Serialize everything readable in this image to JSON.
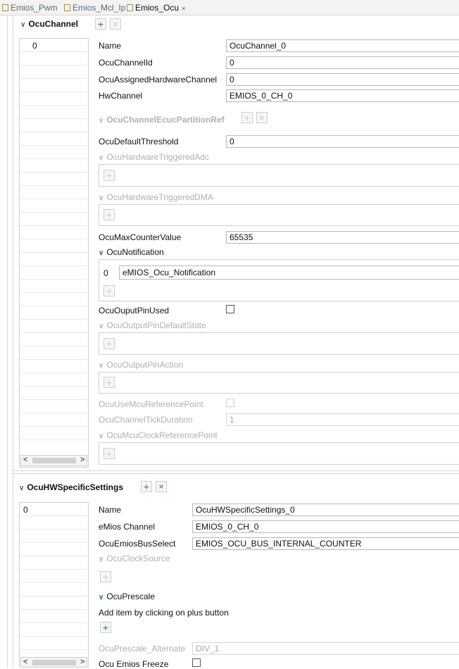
{
  "tabs": [
    {
      "label": "Emios_Pwm"
    },
    {
      "label": "Emios_Mcl_Ip"
    },
    {
      "label": "Emios_Ocu",
      "close": "✕"
    }
  ],
  "ocu_channel": {
    "title": "OcuChannel",
    "list_items": [
      "0"
    ],
    "fields": {
      "name": {
        "label": "Name",
        "value": "OcuChannel_0"
      },
      "channel_id": {
        "label": "OcuChannelId",
        "value": "0"
      },
      "assigned_hw": {
        "label": "OcuAssignedHardwareChannel",
        "value": "0"
      },
      "hw_channel": {
        "label": "HwChannel",
        "value": "EMIOS_0_CH_0"
      },
      "ecuc_ref": {
        "label": "OcuChannelEcucPartitionRef"
      },
      "default_threshold": {
        "label": "OcuDefaultThreshold",
        "value": "0"
      },
      "hw_triggered_adc": {
        "label": "OcuHardwareTriggeredAdc"
      },
      "hw_triggered_dma": {
        "label": "OcuHardwareTriggeredDMA"
      },
      "max_counter": {
        "label": "OcuMaxCounterValue",
        "value": "65535"
      },
      "notification": {
        "label": "OcuNotification",
        "index": "0",
        "value": "eMIOS_Ocu_Notification"
      },
      "output_pin_used": {
        "label": "OcuOuputPinUsed",
        "checked": false
      },
      "output_pin_default_state": {
        "label": "OcuOutputPinDefaultState"
      },
      "output_pin_action": {
        "label": "OcuOutputPinAction"
      },
      "use_mcu_ref_point": {
        "label": "OcuUseMcuReferencePoint",
        "checked": false
      },
      "tick_duration": {
        "label": "OcuChannelTickDuration",
        "value": "1"
      },
      "mcu_clock_ref_point": {
        "label": "OcuMcuClockReferencePoint"
      }
    }
  },
  "hw_specific": {
    "title": "OcuHWSpecificSettings",
    "list_items": [
      "0"
    ],
    "fields": {
      "name": {
        "label": "Name",
        "value": "OcuHWSpecificSettings_0"
      },
      "emios_channel": {
        "label": "eMios Channel",
        "value": "EMIOS_0_CH_0"
      },
      "bus_select": {
        "label": "OcuEmiosBusSelect",
        "value": "EMIOS_OCU_BUS_INTERNAL_COUNTER"
      },
      "clock_source": {
        "label": "OcuClockSource"
      },
      "prescale": {
        "label": "OcuPrescale",
        "hint": "Add item by clicking on plus button"
      },
      "prescale_alt": {
        "label": "OcuPrescale_Alternate",
        "value": "DIV_1"
      },
      "freeze": {
        "label": "Ocu Emios Freeze",
        "checked": false
      }
    }
  },
  "glyphs": {
    "plus": "+",
    "close": "×",
    "chevron": "❯",
    "left": "<",
    "right": ">"
  },
  "colors": {
    "accent_green": "#1e8a4a",
    "disabled": "#b0b0b0"
  }
}
